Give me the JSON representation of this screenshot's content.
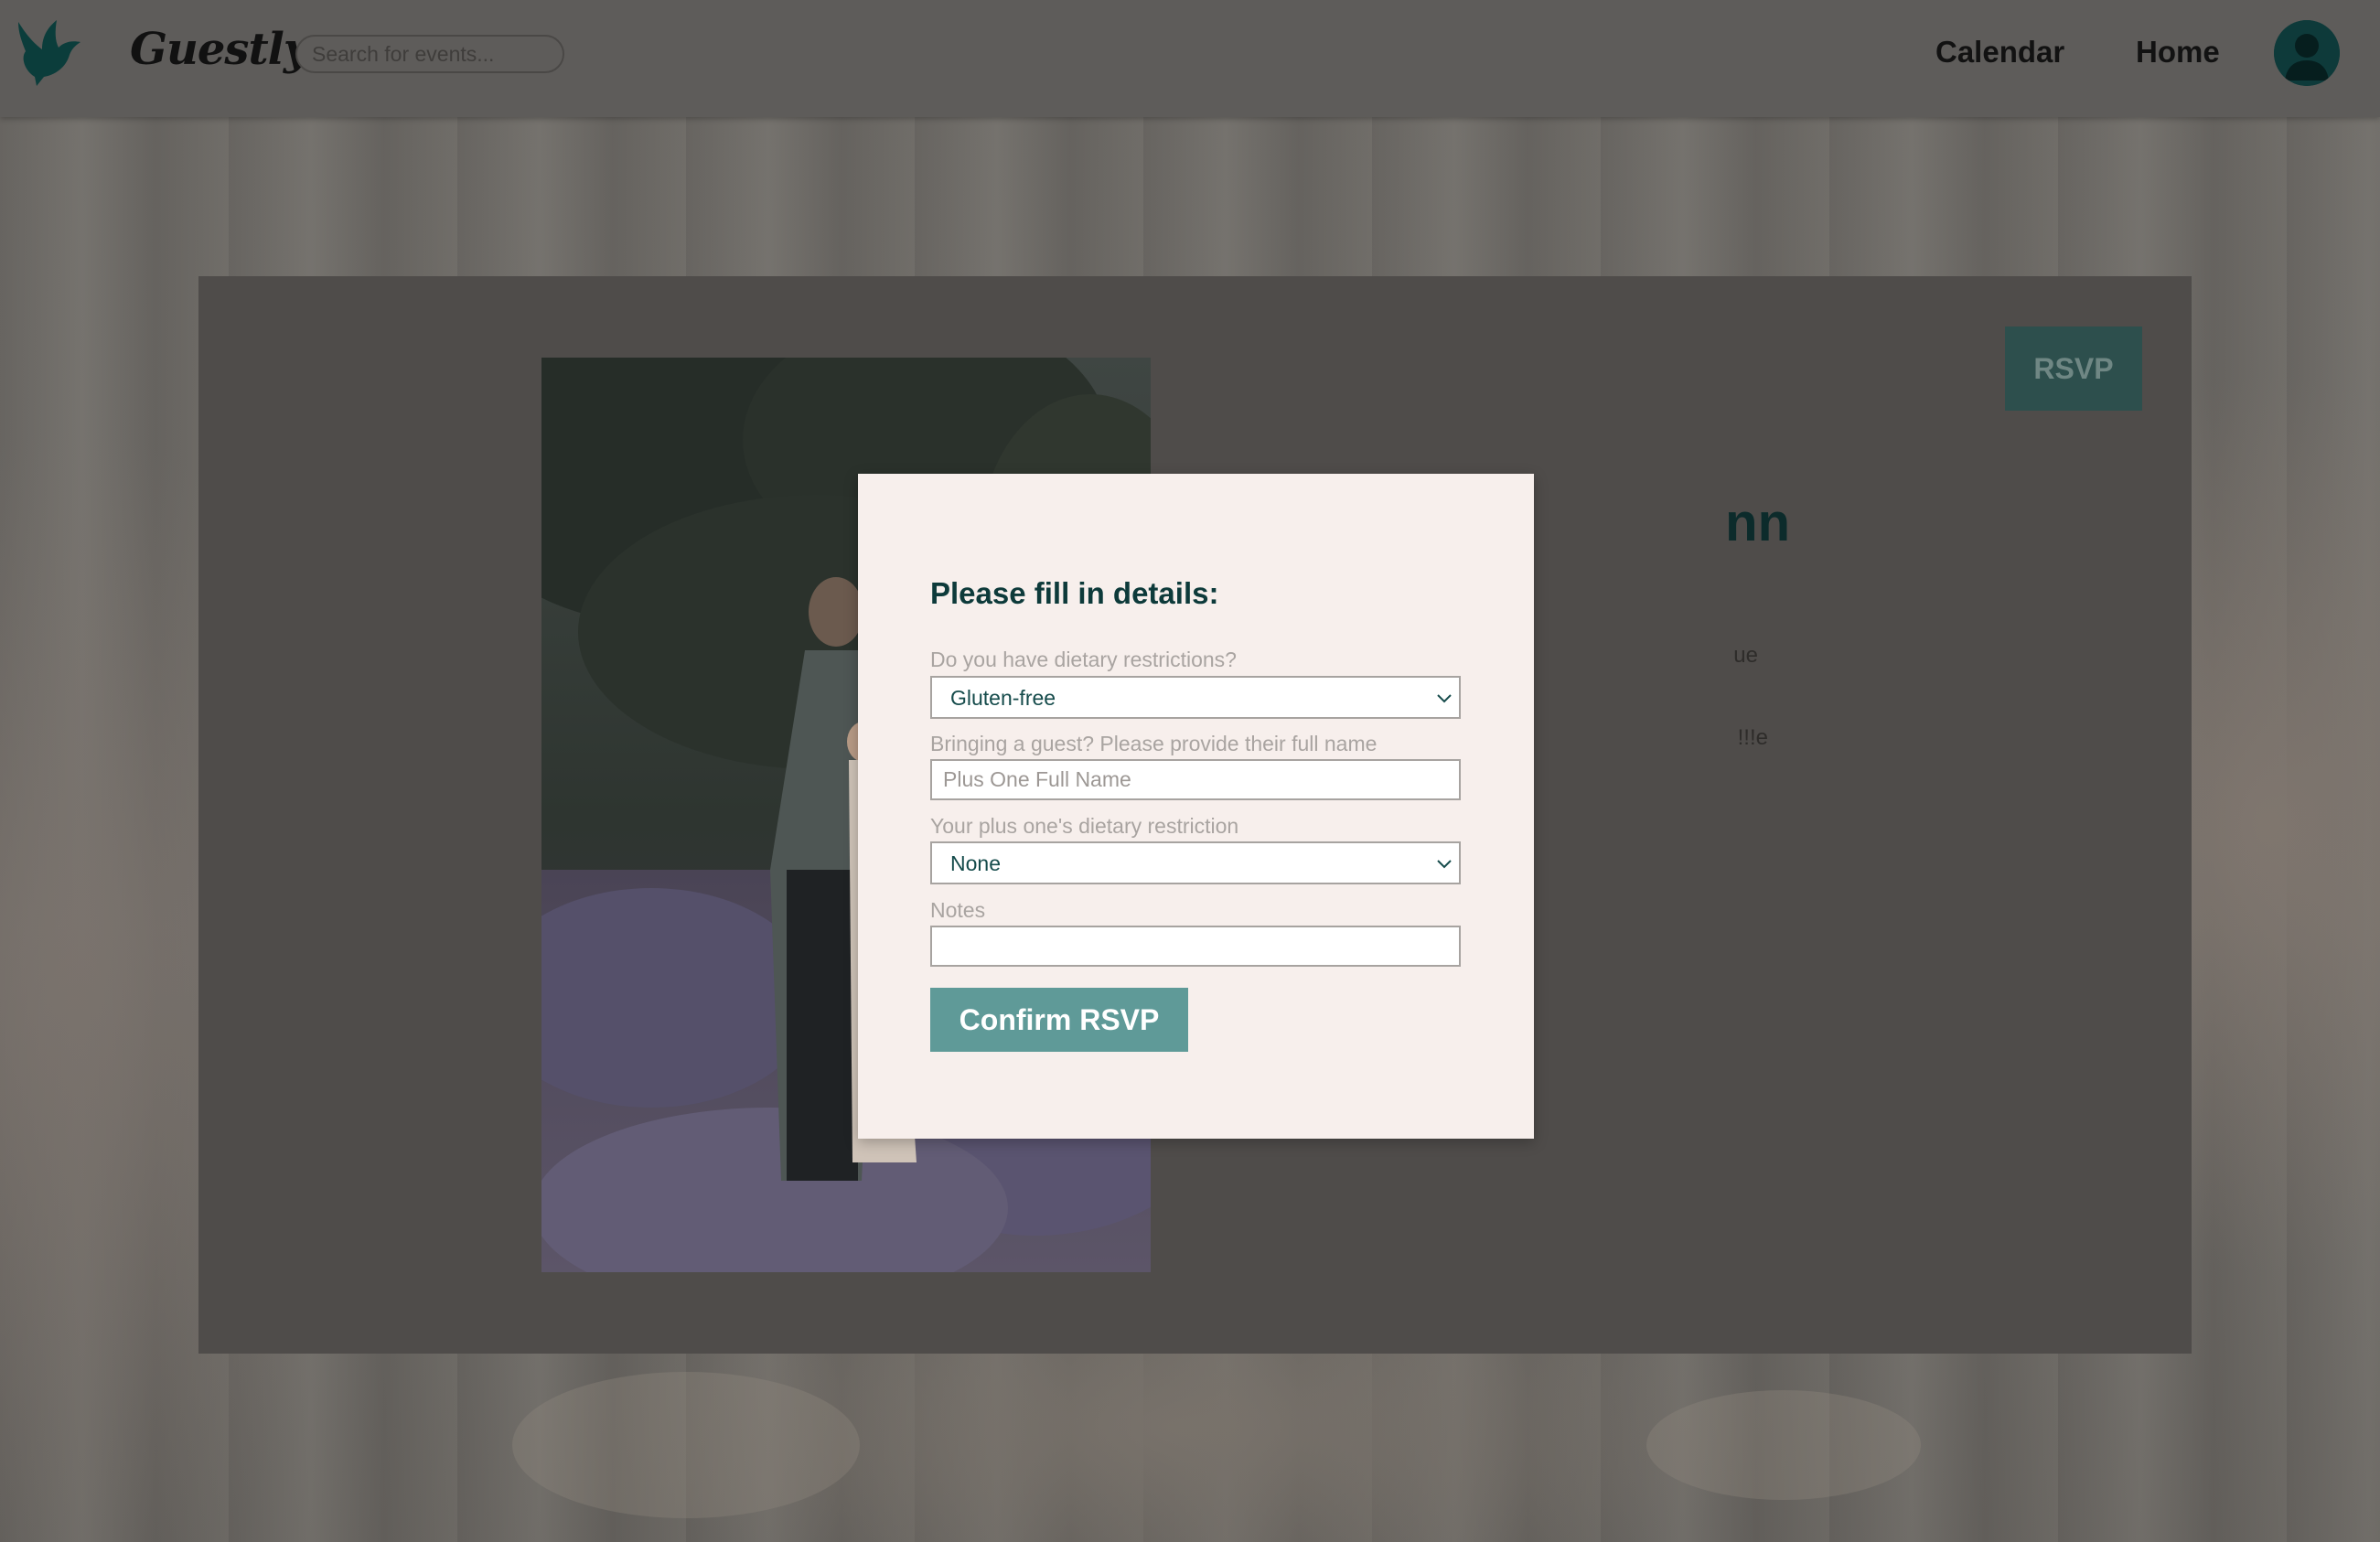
{
  "app": {
    "brand": "Guestly"
  },
  "header": {
    "search": {
      "placeholder": "Search for events..."
    },
    "nav": {
      "calendar_label": "Calendar",
      "home_label": "Home"
    }
  },
  "event": {
    "rsvp_label": "RSVP",
    "title_fragment": "nn",
    "line_1_fragment": "ue",
    "line_2_fragment": "e!!!"
  },
  "modal": {
    "title": "Please fill in details:",
    "dietary": {
      "label": "Do you have dietary restrictions?",
      "selected": "Gluten-free"
    },
    "guest": {
      "label": "Bringing a guest? Please provide their full name",
      "placeholder": "Plus One Full Name",
      "value": ""
    },
    "plus_one_dietary": {
      "label": "Your plus one's dietary restriction",
      "selected": "None"
    },
    "notes": {
      "label": "Notes",
      "value": ""
    },
    "confirm_label": "Confirm RSVP"
  },
  "colors": {
    "brand_teal": "#0d3a3a",
    "button_teal": "#5f9a98",
    "modal_bg": "#f7efec",
    "rsvp_button": "#2d4f4d"
  },
  "icons": {
    "logo": "bird-logo-icon",
    "avatar": "user-avatar-icon",
    "select_arrow": "chevron-down-icon"
  }
}
